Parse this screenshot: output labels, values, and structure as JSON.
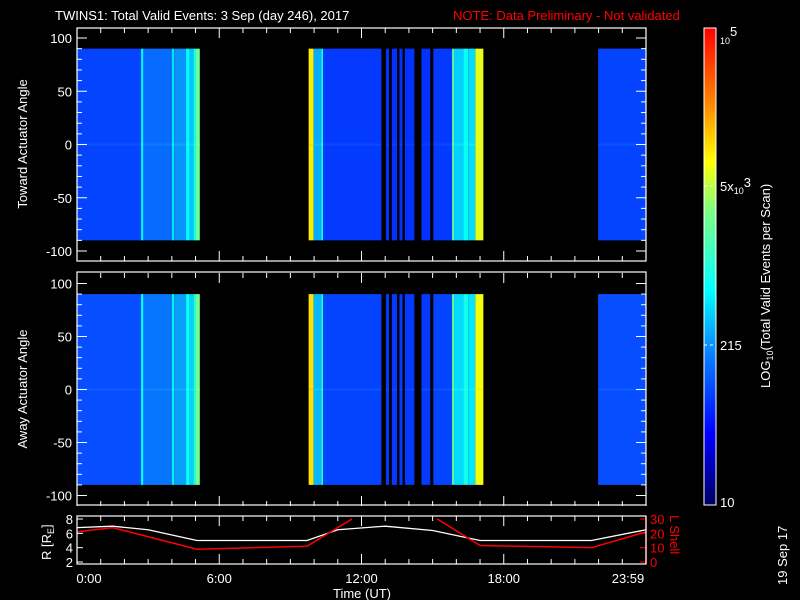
{
  "header": {
    "title": "TWINS1: Total Valid Events:  3 Sep (day 246), 2017",
    "note": "NOTE: Data Preliminary - Not validated"
  },
  "panels": {
    "toward_label": "Toward Actuator Angle",
    "away_label": "Away Actuator Angle",
    "angle_ticks": [
      "100",
      "50",
      "0",
      "-50",
      "-100"
    ],
    "r_label": "R [R",
    "r_label_sub": "E",
    "r_label_end": "]",
    "r_ticks": [
      "8",
      "6",
      "4",
      "2"
    ],
    "l_label": "L Shell",
    "l_ticks": [
      "30",
      "20",
      "10",
      "0"
    ],
    "time_ticks": [
      "0:00",
      "6:00",
      "12:00",
      "18:00",
      "23:59"
    ],
    "time_label": "Time (UT)"
  },
  "colorbar": {
    "label_main": "LOG",
    "label_sub": "10",
    "label_rest": "(Total Valid Events per Scan)",
    "max_base": "10",
    "max_exp": "5",
    "mid_mant": "5x",
    "mid_base": "10",
    "mid_exp": "3",
    "low": "215",
    "min": "10"
  },
  "datestamp": "19 Sep 17",
  "chart_data": {
    "type": "heatmap",
    "title": "TWINS1: Total Valid Events: 3 Sep (day 246), 2017",
    "xlabel": "Time (UT)",
    "xlim_hours": [
      0,
      24
    ],
    "angle_range": [
      -100,
      100
    ],
    "data_angle_range": [
      -90,
      90
    ],
    "color_scale": {
      "type": "log10",
      "range": [
        10,
        100000
      ],
      "stops": [
        [
          0,
          "#000060"
        ],
        [
          0.15,
          "#0000ff"
        ],
        [
          0.33,
          "#0a8cff"
        ],
        [
          0.45,
          "#00ffff"
        ],
        [
          0.62,
          "#80ff80"
        ],
        [
          0.72,
          "#ffff00"
        ],
        [
          0.85,
          "#ff8000"
        ],
        [
          1,
          "#ff0000"
        ]
      ]
    },
    "stripes_log10": [
      [
        0.0,
        2.7,
        1.95
      ],
      [
        2.7,
        2.8,
        2.75
      ],
      [
        2.8,
        4.0,
        2.15
      ],
      [
        4.0,
        4.1,
        2.7
      ],
      [
        4.1,
        4.6,
        2.35
      ],
      [
        4.6,
        4.75,
        2.8
      ],
      [
        4.75,
        4.9,
        2.55
      ],
      [
        4.9,
        5.0,
        2.85
      ],
      [
        5.0,
        5.18,
        3.35
      ],
      [
        9.77,
        9.98,
        3.95
      ],
      [
        9.98,
        10.3,
        2.45
      ],
      [
        10.3,
        10.38,
        2.9
      ],
      [
        10.38,
        12.84,
        1.9
      ],
      [
        13.03,
        13.16,
        1.85
      ],
      [
        13.28,
        13.5,
        1.85
      ],
      [
        13.6,
        13.73,
        1.85
      ],
      [
        13.83,
        14.23,
        1.85
      ],
      [
        14.53,
        14.9,
        1.85
      ],
      [
        15.03,
        15.82,
        1.9
      ],
      [
        15.82,
        15.9,
        3.3
      ],
      [
        15.9,
        16.3,
        2.6
      ],
      [
        16.3,
        16.5,
        2.85
      ],
      [
        16.5,
        16.8,
        2.65
      ],
      [
        16.8,
        17.14,
        3.8
      ],
      [
        21.98,
        24.0,
        1.95
      ]
    ],
    "away_offset_log10": 0.05,
    "orbit": {
      "hours": [
        0,
        1.5,
        3,
        5.06,
        9.7,
        11,
        13,
        15,
        17,
        21.7,
        24
      ],
      "R_RE": [
        6.8,
        7.0,
        6.5,
        5.0,
        5.0,
        6.5,
        7.0,
        6.4,
        5.0,
        5.0,
        6.5
      ],
      "R_range": [
        2,
        8
      ],
      "L_hours": [
        0,
        1.5,
        5.06,
        9.7,
        11.6,
        15.2,
        17.0,
        21.7,
        24
      ],
      "L_shell": [
        21,
        24,
        8.9,
        11,
        30,
        30,
        11.5,
        10,
        21
      ],
      "L_gap": [
        11.6,
        15.2
      ],
      "L_range": [
        0,
        30
      ]
    }
  }
}
